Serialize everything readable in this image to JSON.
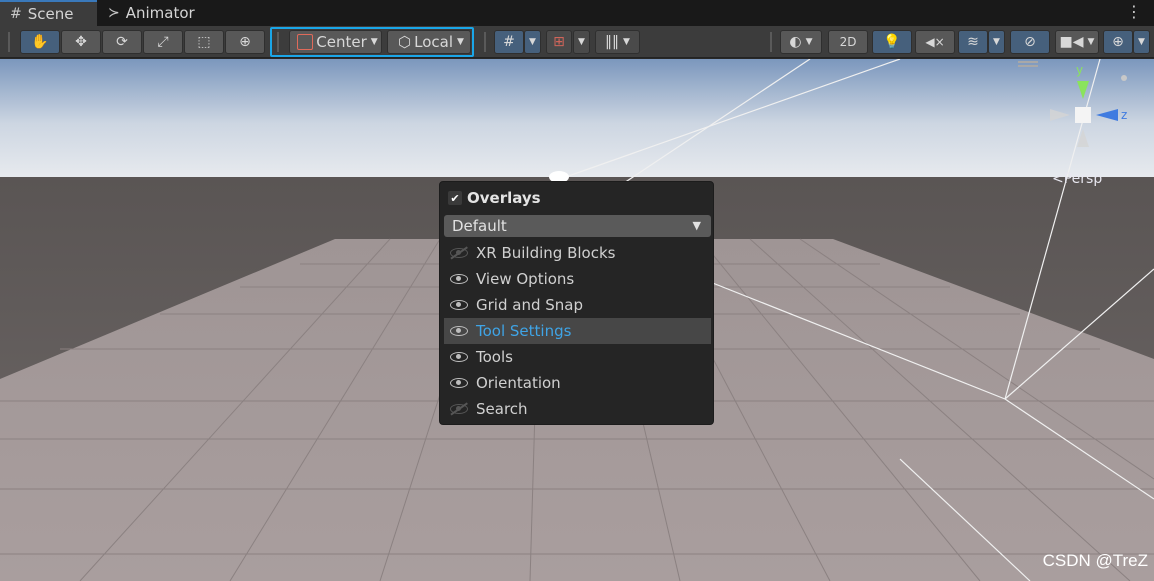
{
  "tabs": [
    {
      "label": "Scene",
      "icon": "grid-hash-icon",
      "glyph": "#"
    },
    {
      "label": "Animator",
      "icon": "animator-icon",
      "glyph": "≻"
    }
  ],
  "toolbar": {
    "pivot_label": "Center",
    "space_label": "Local",
    "mode_2d_label": "2D"
  },
  "gizmo": {
    "y_label": "y",
    "z_label": "z",
    "projection_label": "<Persp"
  },
  "overlays_menu": {
    "title": "Overlays",
    "enabled": true,
    "preset": "Default",
    "items": [
      {
        "label": "XR Building Blocks",
        "visible": false
      },
      {
        "label": "View Options",
        "visible": true
      },
      {
        "label": "Grid and Snap",
        "visible": true
      },
      {
        "label": "Tool Settings",
        "visible": true,
        "selected": true
      },
      {
        "label": "Tools",
        "visible": true
      },
      {
        "label": "Orientation",
        "visible": true
      },
      {
        "label": "Search",
        "visible": false
      }
    ]
  },
  "watermark": "CSDN @TreZ",
  "colors": {
    "highlight_border": "#1aa6e8",
    "selected_text": "#3fa4e6",
    "active_button": "#46607c"
  }
}
